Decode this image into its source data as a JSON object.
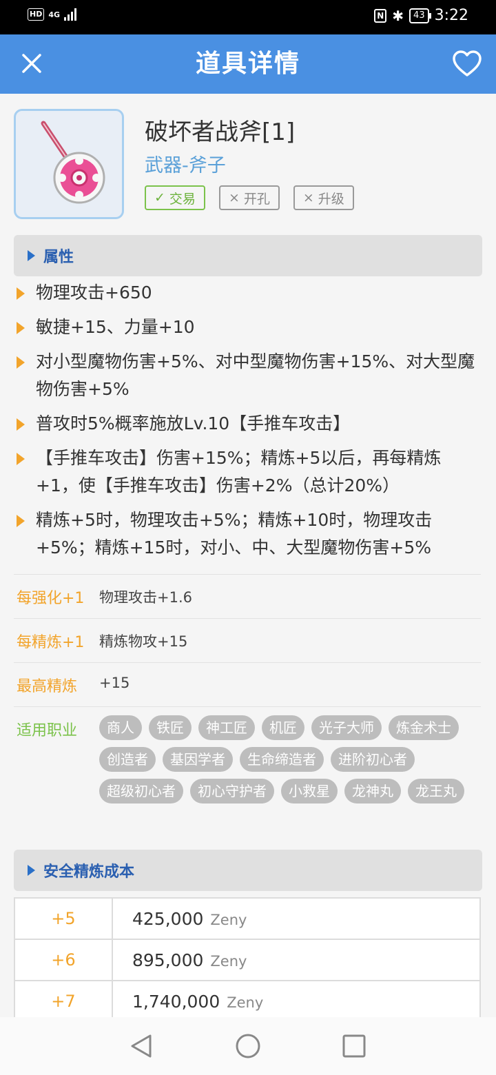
{
  "status": {
    "network": "4G",
    "battery": "43",
    "time": "3:22"
  },
  "appbar": {
    "title": "道具详情"
  },
  "item": {
    "name": "破坏者战斧[1]",
    "type": "武器-斧子",
    "tags": [
      {
        "label": "交易",
        "enabled": true
      },
      {
        "label": "开孔",
        "enabled": false
      },
      {
        "label": "升级",
        "enabled": false
      }
    ]
  },
  "sections": {
    "attributes": "属性",
    "refine_cost": "安全精炼成本"
  },
  "attributes": [
    "物理攻击+650",
    "敏捷+15、力量+10",
    "对小型魔物伤害+5%、对中型魔物伤害+15%、对大型魔物伤害+5%",
    "普攻时5%概率施放Lv.10【手推车攻击】",
    "【手推车攻击】伤害+15%；精炼+5以后，再每精炼+1，使【手推车攻击】伤害+2%（总计20%）",
    "精炼+5时，物理攻击+5%；精炼+10时，物理攻击+5%；精炼+15时，对小、中、大型魔物伤害+5%"
  ],
  "stats": [
    {
      "label": "每强化+1",
      "value": "物理攻击+1.6"
    },
    {
      "label": "每精炼+1",
      "value": "精炼物攻+15"
    },
    {
      "label": "最高精炼",
      "value": "+15"
    }
  ],
  "jobs_label": "适用职业",
  "jobs": [
    "商人",
    "铁匠",
    "神工匠",
    "机匠",
    "光子大师",
    "炼金术士",
    "创造者",
    "基因学者",
    "生命缔造者",
    "进阶初心者",
    "超级初心者",
    "初心守护者",
    "小救星",
    "龙神丸",
    "龙王丸"
  ],
  "refine_costs": [
    {
      "level": "+5",
      "amount": "425,000",
      "unit": "Zeny"
    },
    {
      "level": "+6",
      "amount": "895,000",
      "unit": "Zeny"
    },
    {
      "level": "+7",
      "amount": "1,740,000",
      "unit": "Zeny"
    }
  ],
  "colors": {
    "primary": "#4a90e2",
    "accent": "#f2a42b",
    "green": "#7bc24a",
    "chip": "#bdbdbd"
  }
}
